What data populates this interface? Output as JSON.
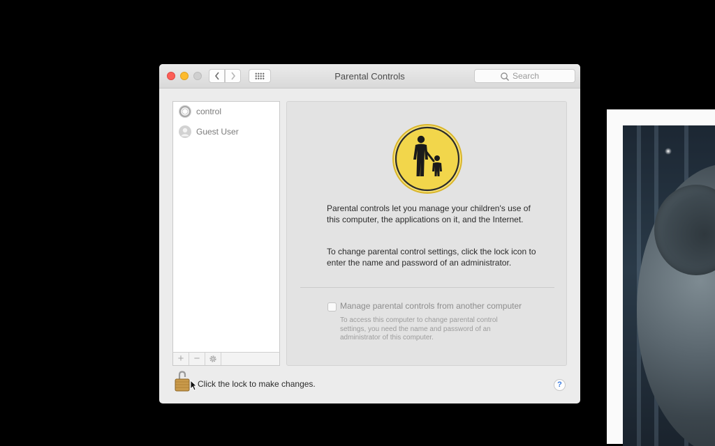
{
  "window": {
    "title": "Parental Controls",
    "search_placeholder": "Search",
    "nav_back_icon": "chevron-left-icon",
    "nav_forward_icon": "chevron-right-icon",
    "show_all_icon": "grid-icon"
  },
  "users": [
    {
      "name": "control",
      "avatar": "soccer-ball-icon"
    },
    {
      "name": "Guest User",
      "avatar": "person-icon"
    }
  ],
  "list_tools": {
    "add": "+",
    "remove": "−"
  },
  "panel": {
    "intro": "Parental controls let you manage your children's use of this computer, the applications on it, and the Internet.",
    "lock_info": "To change parental control settings, click the lock icon to enter the name and password of an administrator.",
    "remote_checkbox_label": "Manage parental controls from another computer",
    "remote_checkbox_checked": false,
    "remote_hint": "To access this computer to change parental control settings, you need the name and password of an administrator of this computer."
  },
  "footer": {
    "lock_text": "Click the lock to make changes.",
    "help_label": "?"
  },
  "colors": {
    "close": "#fc5f57",
    "minimize": "#fdbb2e",
    "zoom": "#cfcfcf",
    "icon_gold": "#f2d64b",
    "help_blue": "#3a7be0"
  }
}
